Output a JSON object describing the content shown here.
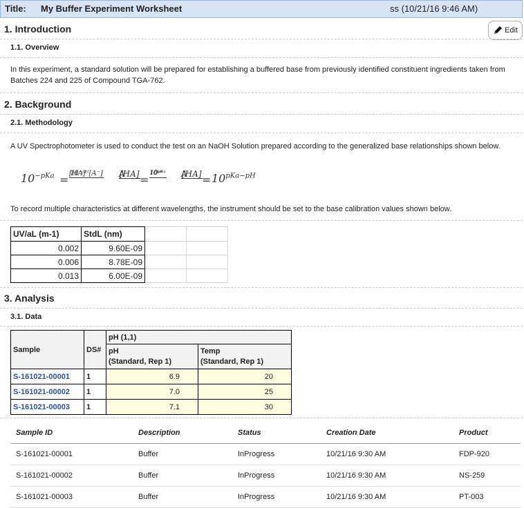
{
  "header": {
    "title_label": "Title:",
    "title": "My Buffer Experiment Worksheet",
    "meta": "ss (10/21/16 9:46 AM)"
  },
  "edit_label": "Edit",
  "sections": {
    "intro": {
      "title": "1. Introduction",
      "sub": "1.1.  Overview",
      "text": "In this experiment, a standard solution will be prepared for establishing a buffered base from previously identified constituent ingredients taken from Batches 224 and 225 of Compound TGA-762."
    },
    "background": {
      "title": "2. Background",
      "sub": "2.1.  Methodology",
      "text": "A UV Spectrophotometer is used to conduct the test on an NaOH Solution prepared according to the generalized base relationships shown below.",
      "text2": "To record multiple characteristics at different wavelengths, the instrument should be set to the base calibration values shown below."
    },
    "analysis": {
      "title": "3. Analysis",
      "sub": "3.1.  Data"
    }
  },
  "equations": {
    "eq1_lhs": "10",
    "eq1_lhs_exp": "−pKa",
    "eq1_num": "10⁻ᵖᴴ[A⁻]",
    "eq1_den": "[HA]",
    "eq2_num": "[HA]",
    "eq2_den": "A⁻",
    "eq2_rnum": "10ᵖᴷᵃ",
    "eq2_rden": "10ᵖᴴ",
    "eq3_num": "[HA]",
    "eq3_den": "A⁻",
    "eq3_rhs": "10",
    "eq3_rhs_exp": "pKa−pH",
    "eq_sign": "="
  },
  "calibration": {
    "headers": [
      "UV/aL (m-1)",
      "StdL (nm)"
    ],
    "rows": [
      [
        "0.002",
        "9.60E-09"
      ],
      [
        "0.006",
        "8.78E-09"
      ],
      [
        "0.013",
        "6.00E-09"
      ]
    ]
  },
  "data_table": {
    "col_sample": "Sample",
    "col_ds": "DS#",
    "group": "pH (1,1)",
    "col_ph": "pH",
    "col_ph_sub": "(Standard, Rep 1)",
    "col_temp": "Temp",
    "col_temp_sub": "(Standard, Rep 1)",
    "rows": [
      {
        "sample": "S-161021-00001",
        "ds": "1",
        "ph": "6.9",
        "temp": "20"
      },
      {
        "sample": "S-161021-00002",
        "ds": "1",
        "ph": "7.0",
        "temp": "25"
      },
      {
        "sample": "S-161021-00003",
        "ds": "1",
        "ph": "7.1",
        "temp": "30"
      }
    ]
  },
  "sample_grid": {
    "headers": [
      "Sample ID",
      "Description",
      "Status",
      "Creation Date",
      "Product"
    ],
    "rows": [
      [
        "S-161021-00001",
        "Buffer",
        "InProgress",
        "10/21/16 9:30 AM",
        "FDP-920"
      ],
      [
        "S-161021-00002",
        "Buffer",
        "InProgress",
        "10/21/16 9:30 AM",
        "NS-259"
      ],
      [
        "S-161021-00003",
        "Buffer",
        "InProgress",
        "10/21/16 9:30 AM",
        "PT-003"
      ]
    ]
  }
}
